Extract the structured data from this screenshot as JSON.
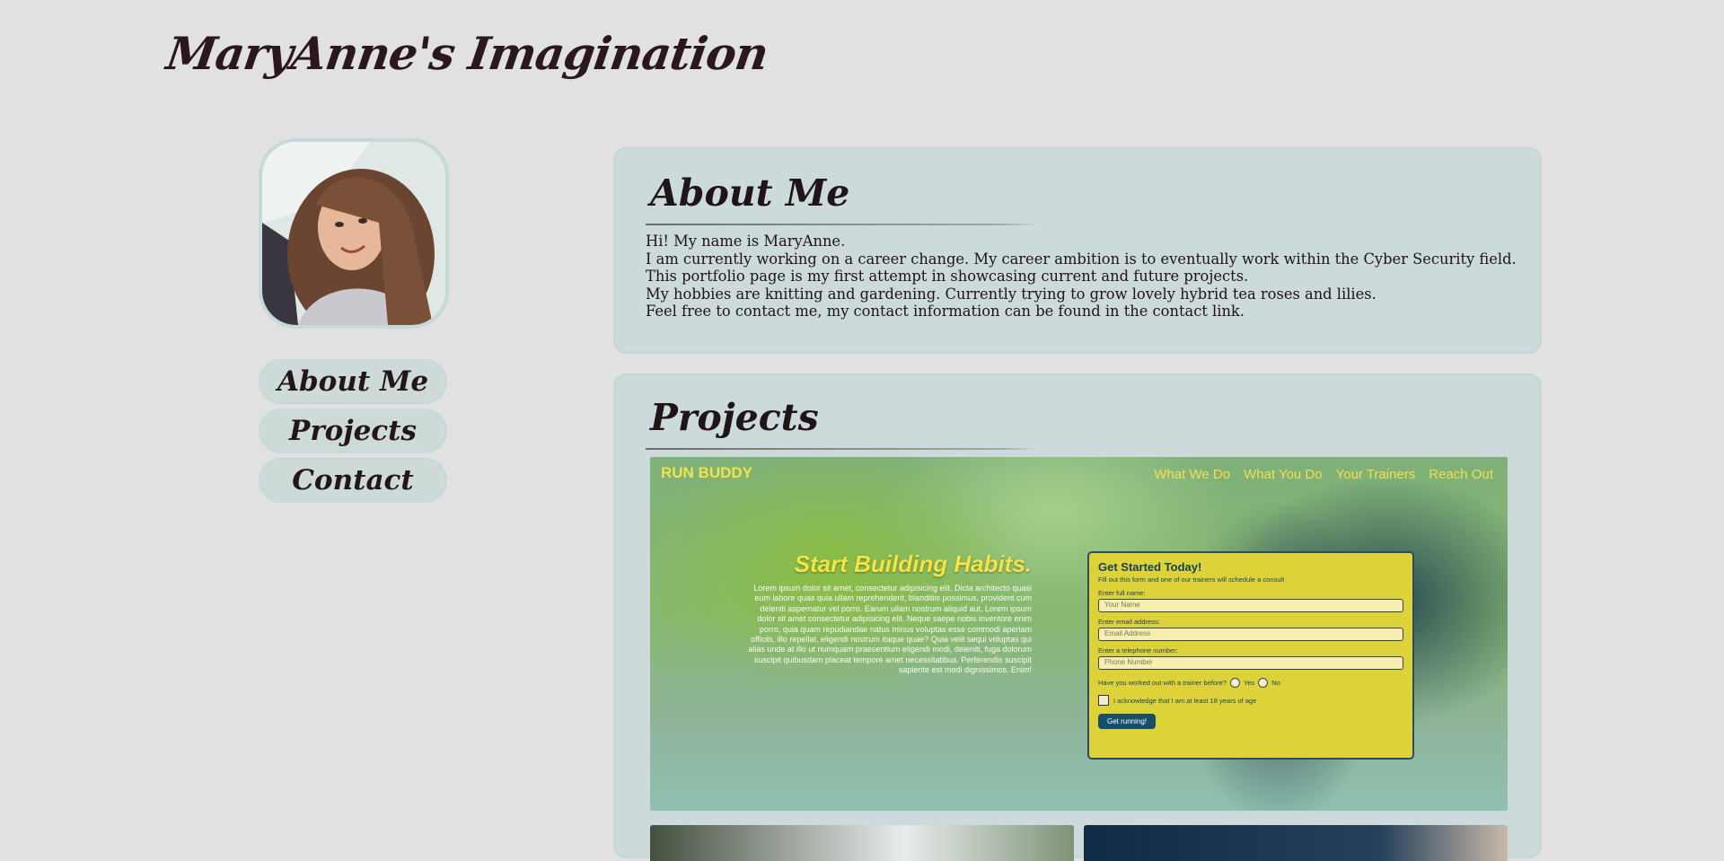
{
  "site": {
    "title": "MaryAnne's Imagination"
  },
  "sidebar": {
    "nav": [
      {
        "label": "About Me"
      },
      {
        "label": "Projects"
      },
      {
        "label": "Contact"
      }
    ]
  },
  "about": {
    "heading": "About Me",
    "lines": [
      "Hi! My name is MaryAnne.",
      "I am currently working on a career change. My career ambition is to eventually work within the Cyber Security field.",
      "This portfolio page is my first attempt in showcasing current and future projects.",
      "My hobbies are knitting and gardening. Currently trying to grow lovely hybrid tea roses and lilies.",
      "Feel free to contact me, my contact information can be found in the contact link."
    ]
  },
  "projects": {
    "heading": "Projects",
    "run_buddy": {
      "brand": "RUN BUDDY",
      "nav": [
        "What We Do",
        "What You Do",
        "Your Trainers",
        "Reach Out"
      ],
      "hero_title": "Start Building Habits.",
      "hero_text": "Lorem ipsum dolor sit amet, consectetur adipisicing elit. Dicta architecto quasi eum labore quas quia ullam reprehenderit, blanditiis possimus, provident cum deleniti aspernatur vel porro. Earum ullam nostrum aliquid aut. Lorem ipsum dolor sit amet consectetur adipisicing elit. Neque saepe nobis inventore enim porro, quia quam repudiandae natus minus voluptas esse commodi aperiam officiis, illo repellat, eligendi nostrum itaque quae? Quia velit sequi voluptas qui alias unde at illo ut numquam praesentium eligendi modi, deleniti, fuga dolorum suscipit quibusdam placeat tempore amet necessitatibus. Perferendis suscipit sapiente est modi dignissimos. Enim!",
      "form": {
        "title": "Get Started Today!",
        "subtitle": "Fill out this form and one of our trainers will schedule a consult",
        "name_label": "Enter full name:",
        "name_placeholder": "Your Name",
        "email_label": "Enter email address:",
        "email_placeholder": "Email Address",
        "phone_label": "Enter a telephone number:",
        "phone_placeholder": "Phone Number",
        "trainer_question": "Have you worked out with a trainer before?",
        "yes": "Yes",
        "no": "No",
        "age_ack": "I acknowledge that I am at least 18 years of age",
        "submit": "Get running!"
      }
    }
  },
  "colors": {
    "page_bg": "#e1e1e1",
    "panel_bg": "#cddadb",
    "accent_yellow": "#f2e34a",
    "button_blue": "#164e6b"
  }
}
